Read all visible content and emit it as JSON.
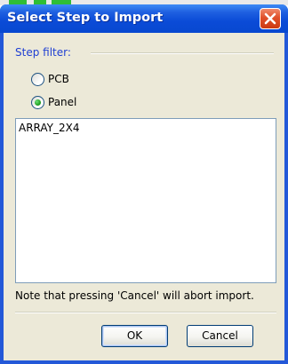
{
  "dialog": {
    "title": "Select Step to Import",
    "colors": {
      "titlebar": "#0a4bd7",
      "client": "#ece9d8",
      "group_label": "#1f3fd3",
      "close_button": "#e0502a"
    }
  },
  "step_filter": {
    "label": "Step filter:",
    "options": [
      {
        "label": "PCB",
        "selected": false
      },
      {
        "label": "Panel",
        "selected": true
      }
    ]
  },
  "steps": {
    "items": [
      "ARRAY_2X4"
    ]
  },
  "note": "Note that pressing 'Cancel' will abort import.",
  "buttons": {
    "ok_label": "OK",
    "cancel_label": "Cancel"
  }
}
